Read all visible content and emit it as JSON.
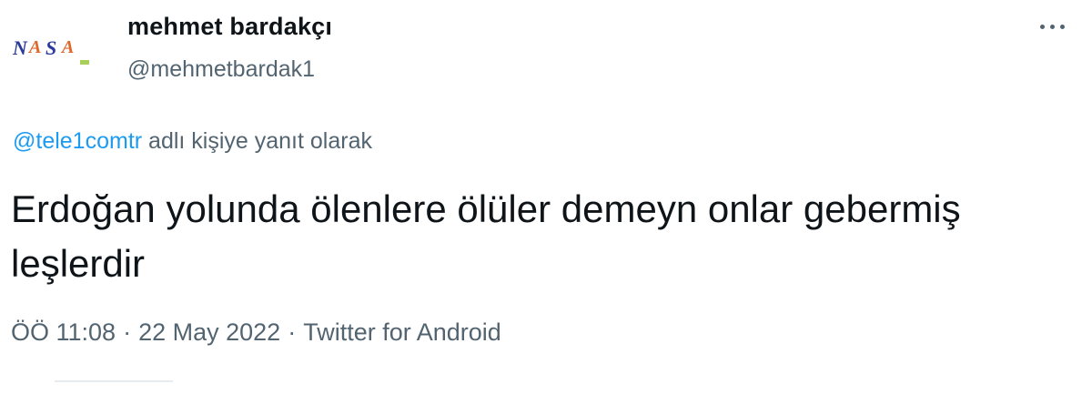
{
  "author": {
    "display_name": "mehmet bardakçı",
    "handle": "@mehmetbardak1",
    "avatar_text": "NASA"
  },
  "reply": {
    "mention": "@tele1comtr",
    "suffix": " adlı kişiye yanıt olarak"
  },
  "tweet": {
    "text": "Erdoğan yolunda ölenlere ölüler demeyn onlar gebermiş leşlerdir"
  },
  "meta": {
    "time": "ÖÖ 11:08",
    "separator_1": "·",
    "date": "22 May 2022",
    "separator_2": "·",
    "source": "Twitter for Android"
  },
  "icons": {
    "more": "more-horizontal-icon"
  },
  "colors": {
    "primary_text": "#0f1419",
    "secondary_text": "#536471",
    "link": "#1d9bf0"
  }
}
